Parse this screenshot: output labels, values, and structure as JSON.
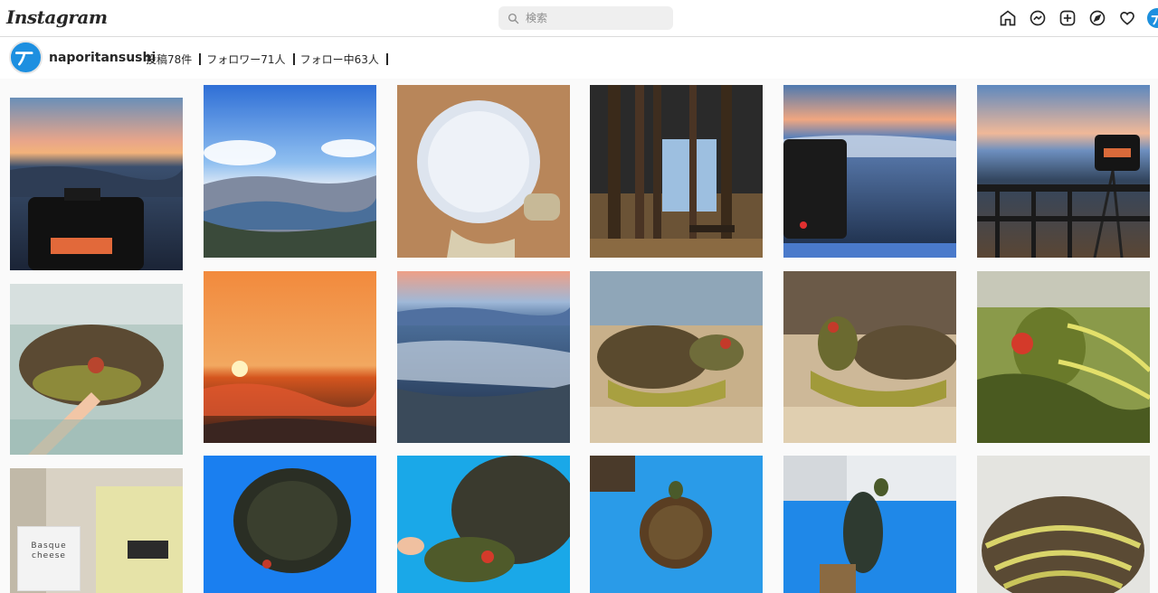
{
  "app": {
    "logo": "Instagram"
  },
  "search": {
    "placeholder": "検索"
  },
  "nav": {
    "icons": [
      "home-icon",
      "messenger-icon",
      "new-post-icon",
      "explore-icon",
      "heart-icon",
      "profile-avatar"
    ]
  },
  "profile": {
    "username": "naporitansushi",
    "posts": "投稿78件",
    "followers": "フォロワー71人",
    "following": "フォロー中63人"
  },
  "grid": {
    "tiles": [
      "sunset-camera-on-mountain",
      "coastal-city-panorama",
      "snow-cup-closeup",
      "forest-trees-bench",
      "camera-sea-of-clouds",
      "camera-tripod-railing",
      "turtle-in-aquarium-finger",
      "orange-sunrise-clouds",
      "mountain-sea-of-clouds",
      "turtle-on-sand-side",
      "turtle-on-sand-head-up",
      "turtle-closeup-head",
      "basque-cheese-jar",
      "turtle-on-blue-tub",
      "turtle-swimming-blue",
      "turtle-in-blue-basin",
      "turtle-climbing-wall",
      "turtle-underside-closeup"
    ],
    "basque_label_line1": "Basque",
    "basque_label_line2": "cheese"
  },
  "colors": {
    "accent": "#1d8fe0",
    "border": "#dbdbdb",
    "background": "#fafafa"
  }
}
